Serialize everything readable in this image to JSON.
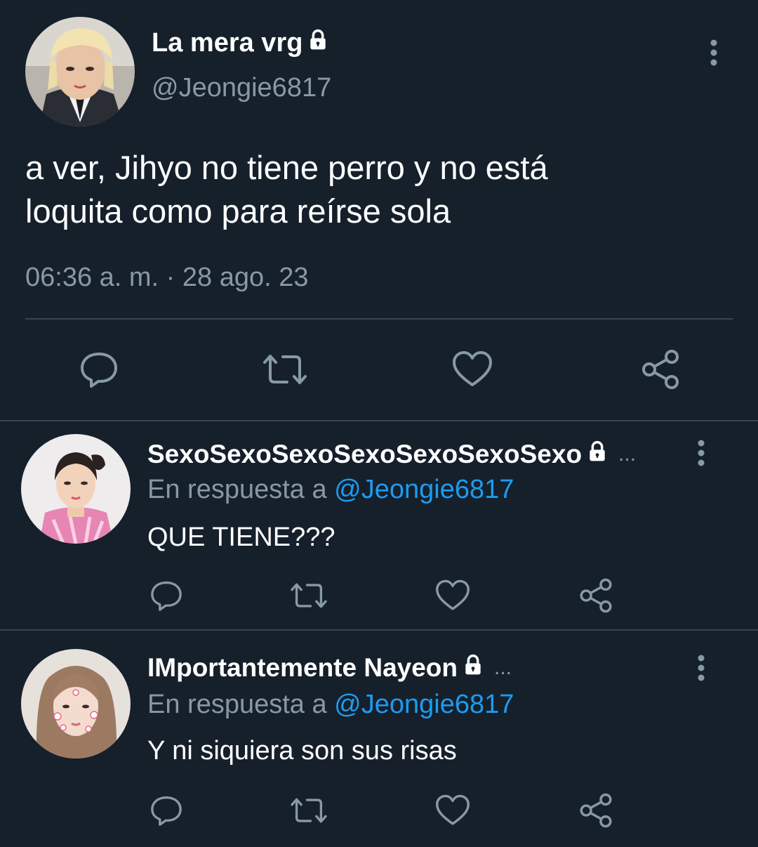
{
  "main_tweet": {
    "display_name": "La mera vrg",
    "handle": "@Jeongie6817",
    "text_line1": "a ver, Jihyo no tiene perro y no está",
    "text_line2": "loquita como para reírse sola",
    "timestamp": "06:36 a. m. · 28 ago. 23"
  },
  "replies": [
    {
      "display_name": "SexoSexoSexoSexoSexoSexoSexo",
      "truncation": "...",
      "reply_prefix": "En respuesta a",
      "reply_to": "@Jeongie6817",
      "text": "QUE TIENE???"
    },
    {
      "display_name": "IMportantemente Nayeon",
      "truncation": "...",
      "reply_prefix": "En respuesta a",
      "reply_to": "@Jeongie6817",
      "text": "Y ni siquiera son sus risas"
    }
  ],
  "icons": [
    "lock-icon",
    "more-vertical-icon",
    "reply-icon",
    "retweet-icon",
    "like-icon",
    "share-icon"
  ],
  "colors": {
    "background": "#15202b",
    "secondary_text": "#8899a6",
    "mention": "#1d9bf0",
    "divider": "#38444d"
  }
}
